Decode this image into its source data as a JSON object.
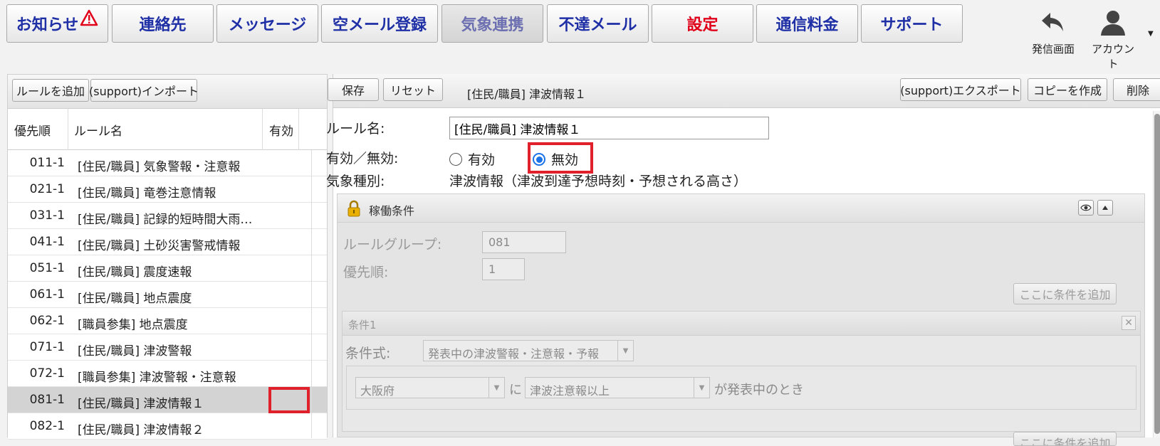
{
  "nav": {
    "items": [
      {
        "label": "お知らせ"
      },
      {
        "label": "連絡先"
      },
      {
        "label": "メッセージ"
      },
      {
        "label": "空メール登録"
      },
      {
        "label": "気象連携"
      },
      {
        "label": "不達メール"
      },
      {
        "label": "設定"
      },
      {
        "label": "通信料金"
      },
      {
        "label": "サポート"
      }
    ],
    "send_screen_label": "発信画面",
    "account_label": "アカウント"
  },
  "left": {
    "add_rule_label": "ルールを追加",
    "import_label": "(support)インポート",
    "col_priority": "優先順",
    "col_name": "ルール名",
    "col_enabled": "有効",
    "rows": [
      {
        "priority": "011-1",
        "name": "[住民/職員] 気象警報・注意報"
      },
      {
        "priority": "021-1",
        "name": "[住民/職員] 竜巻注意情報"
      },
      {
        "priority": "031-1",
        "name": "[住民/職員] 記録的短時間大雨…"
      },
      {
        "priority": "041-1",
        "name": "[住民/職員] 土砂災害警戒情報"
      },
      {
        "priority": "051-1",
        "name": "[住民/職員] 震度速報"
      },
      {
        "priority": "061-1",
        "name": "[住民/職員] 地点震度"
      },
      {
        "priority": "062-1",
        "name": "[職員参集] 地点震度"
      },
      {
        "priority": "071-1",
        "name": "[住民/職員] 津波警報"
      },
      {
        "priority": "072-1",
        "name": "[職員参集] 津波警報・注意報"
      },
      {
        "priority": "081-1",
        "name": "[住民/職員] 津波情報１"
      },
      {
        "priority": "082-1",
        "name": "[住民/職員] 津波情報２"
      }
    ]
  },
  "right": {
    "save_label": "保存",
    "reset_label": "リセット",
    "title": "[住民/職員] 津波情報１",
    "export_label": "(support)エクスポート",
    "copy_label": "コピーを作成",
    "delete_label": "削除",
    "rule_name_label": "ルール名:",
    "rule_name_value": "[住民/職員] 津波情報１",
    "enabled_label": "有効／無効:",
    "enabled_on": "有効",
    "enabled_off": "無効",
    "weather_type_label": "気象種別:",
    "weather_type_value": "津波情報（津波到達予想時刻・予想される高さ）",
    "section_title": "稼働条件",
    "rule_group_label": "ルールグループ:",
    "rule_group_value": "081",
    "priority_label": "優先順:",
    "priority_value": "1",
    "add_condition_label": "ここに条件を追加",
    "condition_title": "条件1",
    "condition_expr_label": "条件式:",
    "condition_expr_value": "発表中の津波警報・注意報・予報",
    "prefecture_value": "大阪府",
    "particle_ni": "に",
    "level_value": "津波注意報以上",
    "suffix_text": "が発表中のとき"
  },
  "colors": {
    "nav_text": "#1f2fa6",
    "nav_active_text": "#6c6fb0",
    "settings_text": "#e0001a",
    "highlight": "#e0202a",
    "radio": "#1a73e8"
  }
}
